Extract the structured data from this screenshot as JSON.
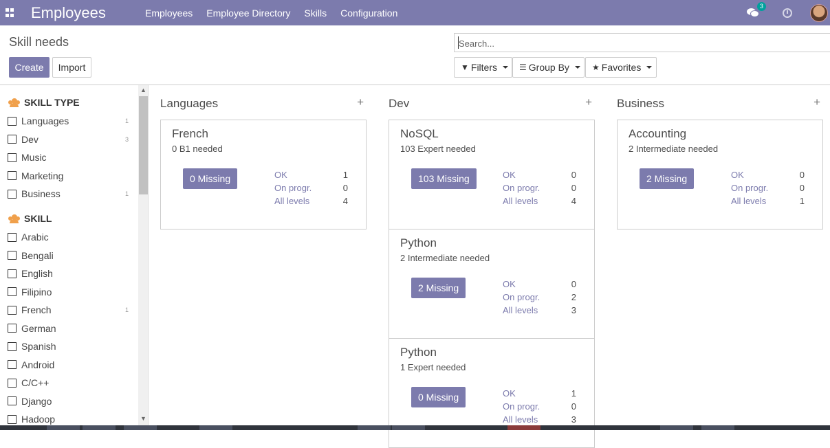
{
  "navbar": {
    "brand": "Employees",
    "menu": [
      "Employees",
      "Employee Directory",
      "Skills",
      "Configuration"
    ],
    "chat_count": "3"
  },
  "control_panel": {
    "title": "Skill needs",
    "create_label": "Create",
    "import_label": "Import",
    "search_placeholder": "Search...",
    "filters_label": "Filters",
    "group_by_label": "Group By",
    "favorites_label": "Favorites"
  },
  "side_panel": {
    "skill_type_title": "SKILL TYPE",
    "skill_types": [
      {
        "label": "Languages",
        "count": "1"
      },
      {
        "label": "Dev",
        "count": "3"
      },
      {
        "label": "Music",
        "count": ""
      },
      {
        "label": "Marketing",
        "count": ""
      },
      {
        "label": "Business",
        "count": "1"
      }
    ],
    "skill_title": "SKILL",
    "skills": [
      {
        "label": "Arabic",
        "count": ""
      },
      {
        "label": "Bengali",
        "count": ""
      },
      {
        "label": "English",
        "count": ""
      },
      {
        "label": "Filipino",
        "count": ""
      },
      {
        "label": "French",
        "count": "1"
      },
      {
        "label": "German",
        "count": ""
      },
      {
        "label": "Spanish",
        "count": ""
      },
      {
        "label": "Android",
        "count": ""
      },
      {
        "label": "C/C++",
        "count": ""
      },
      {
        "label": "Django",
        "count": ""
      },
      {
        "label": "Hadoop",
        "count": ""
      }
    ]
  },
  "kanban": {
    "stat_labels": {
      "ok": "OK",
      "progress": "On progr.",
      "all": "All levels"
    },
    "columns": [
      {
        "title": "Languages",
        "cards": [
          {
            "title": "French",
            "subtitle": "0 B1 needed",
            "missing": "0 Missing",
            "ok": "1",
            "progress": "0",
            "all": "4"
          }
        ]
      },
      {
        "title": "Dev",
        "cards": [
          {
            "title": "NoSQL",
            "subtitle": "103 Expert needed",
            "missing": "103 Missing",
            "ok": "0",
            "progress": "0",
            "all": "4"
          },
          {
            "title": "Python",
            "subtitle": "2 Intermediate needed",
            "missing": "2 Missing",
            "ok": "0",
            "progress": "2",
            "all": "3"
          },
          {
            "title": "Python",
            "subtitle": "1 Expert needed",
            "missing": "0 Missing",
            "ok": "1",
            "progress": "0",
            "all": "3"
          }
        ]
      },
      {
        "title": "Business",
        "cards": [
          {
            "title": "Accounting",
            "subtitle": "2 Intermediate needed",
            "missing": "2 Missing",
            "ok": "0",
            "progress": "0",
            "all": "1"
          }
        ]
      }
    ]
  },
  "colors": {
    "primary": "#7c7bad",
    "badge": "#00a09d",
    "accent_icon": "#f0a04b"
  }
}
